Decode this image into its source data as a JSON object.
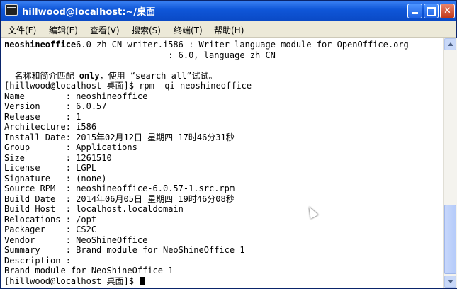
{
  "window": {
    "title": "hillwood@localhost:~/桌面"
  },
  "menu": [
    {
      "label": "文件(F)"
    },
    {
      "label": "编辑(E)"
    },
    {
      "label": "查看(V)"
    },
    {
      "label": "搜索(S)"
    },
    {
      "label": "终端(T)"
    },
    {
      "label": "帮助(H)"
    }
  ],
  "terminal": {
    "search_result_pkg": "neoshineoffice",
    "search_result_rest": "6.0-zh-CN-writer.i586 : Writer language module for OpenOffice.org",
    "search_result_cont": "                                : 6.0, language zh_CN",
    "hint_prefix": "  名称和简介匹配 ",
    "hint_bold": "only",
    "hint_suffix": "，使用 “search all”试试。",
    "prompt_cmd": "[hillwood@localhost 桌面]$ rpm -qi neoshineoffice",
    "fields": [
      "Name        : neoshineoffice",
      "Version     : 6.0.57",
      "Release     : 1",
      "Architecture: i586",
      "Install Date: 2015年02月12日 星期四 17时46分31秒",
      "Group       : Applications",
      "Size        : 1261510",
      "License     : LGPL",
      "Signature   : (none)",
      "Source RPM  : neoshineoffice-6.0.57-1.src.rpm",
      "Build Date  : 2014年06月05日 星期四 19时46分08秒",
      "Build Host  : localhost.localdomain",
      "Relocations : /opt",
      "Packager    : CS2C",
      "Vendor      : NeoShineOffice",
      "Summary     : Brand module for NeoShineOffice 1",
      "Description :",
      "Brand module for NeoShineOffice 1"
    ],
    "final_prompt": "[hillwood@localhost 桌面]$ "
  }
}
